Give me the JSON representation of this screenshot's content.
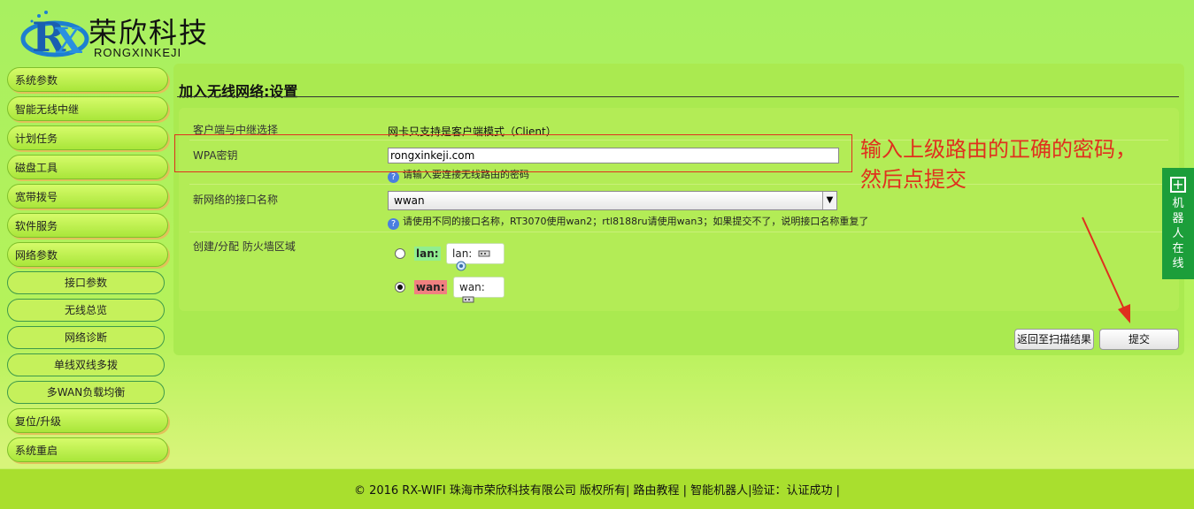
{
  "header": {
    "logo_cn": "荣欣科技",
    "logo_en": "RONGXINKEJI"
  },
  "sidebar": {
    "items": [
      {
        "label": "系统参数"
      },
      {
        "label": "智能无线中继"
      },
      {
        "label": "计划任务"
      },
      {
        "label": "磁盘工具"
      },
      {
        "label": "宽带拨号"
      },
      {
        "label": "软件服务"
      },
      {
        "label": "网络参数"
      }
    ],
    "sub_items": [
      {
        "label": "接口参数"
      },
      {
        "label": "无线总览"
      },
      {
        "label": "网络诊断"
      },
      {
        "label": "单线双线多拨"
      },
      {
        "label": "多WAN负载均衡"
      }
    ],
    "bottom_items": [
      {
        "label": "复位/升级"
      },
      {
        "label": "系统重启"
      }
    ]
  },
  "main": {
    "title": "加入无线网络:设置",
    "form": {
      "mode_label": "客户端与中继选择",
      "mode_value": "网卡只支持是客户端模式（Client）",
      "wpa_label": "WPA密钥",
      "wpa_value": "rongxinkeji.com",
      "wpa_hint": "请输入要连接无线路由的密码",
      "iface_label": "新网络的接口名称",
      "iface_value": "wwan",
      "iface_hint": "请使用不同的接口名称，RT3070使用wan2；rtl8188ru请使用wan3；如果提交不了，说明接口名称重复了",
      "zone_label": "创建/分配 防火墙区域",
      "zone_lan_tag": "lan:",
      "zone_lan_card": "lan:",
      "zone_wan_tag": "wan:",
      "zone_wan_card": "wan:",
      "zone_selected": "wan"
    },
    "buttons": {
      "back_label": "返回至扫描结果",
      "submit_label": "提交"
    }
  },
  "annotation": {
    "line1": "输入上级路由的正确的密码，",
    "line2": "然后点提交"
  },
  "robot_tab": {
    "plus": "+",
    "label": "机器人在线"
  },
  "footer": {
    "text": "© 2016 RX-WIFI 珠海市荣欣科技有限公司 版权所有| 路由教程 | 智能机器人|验证：认证成功 |"
  },
  "colors": {
    "accent_green": "#1c9e3a",
    "annotation_red": "#e0301e",
    "lan_tag_bg": "#90ee90",
    "wan_tag_bg": "#f08080"
  }
}
